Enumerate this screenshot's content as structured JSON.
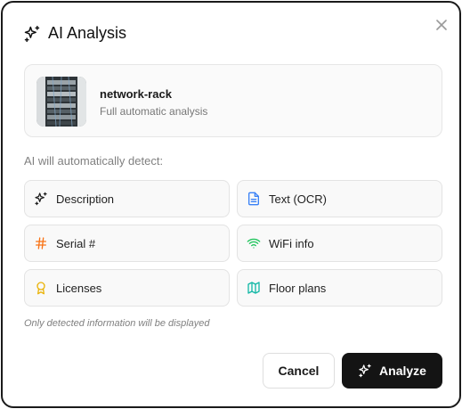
{
  "dialog": {
    "title": "AI Analysis",
    "title_icon": "sparkles-icon",
    "close_icon": "close-icon"
  },
  "file": {
    "name": "network-rack",
    "subtitle": "Full automatic analysis",
    "thumbnail": "network-rack-photo"
  },
  "detect_label": "AI will automatically detect:",
  "features": [
    {
      "label": "Description",
      "icon": "sparkles-icon",
      "color": "#1f1f1f"
    },
    {
      "label": "Text (OCR)",
      "icon": "document-icon",
      "color": "#3b82f6"
    },
    {
      "label": "Serial #",
      "icon": "hash-icon",
      "color": "#f97316"
    },
    {
      "label": "WiFi info",
      "icon": "wifi-icon",
      "color": "#22c55e"
    },
    {
      "label": "Licenses",
      "icon": "award-icon",
      "color": "#eab308"
    },
    {
      "label": "Floor plans",
      "icon": "map-icon",
      "color": "#14b8a6"
    }
  ],
  "note": "Only detected information will be displayed",
  "buttons": {
    "cancel": "Cancel",
    "analyze": "Analyze"
  },
  "colors": {
    "primary_button": "#141414",
    "card_bg": "#f9f9f9",
    "border": "#e3e3e3"
  }
}
